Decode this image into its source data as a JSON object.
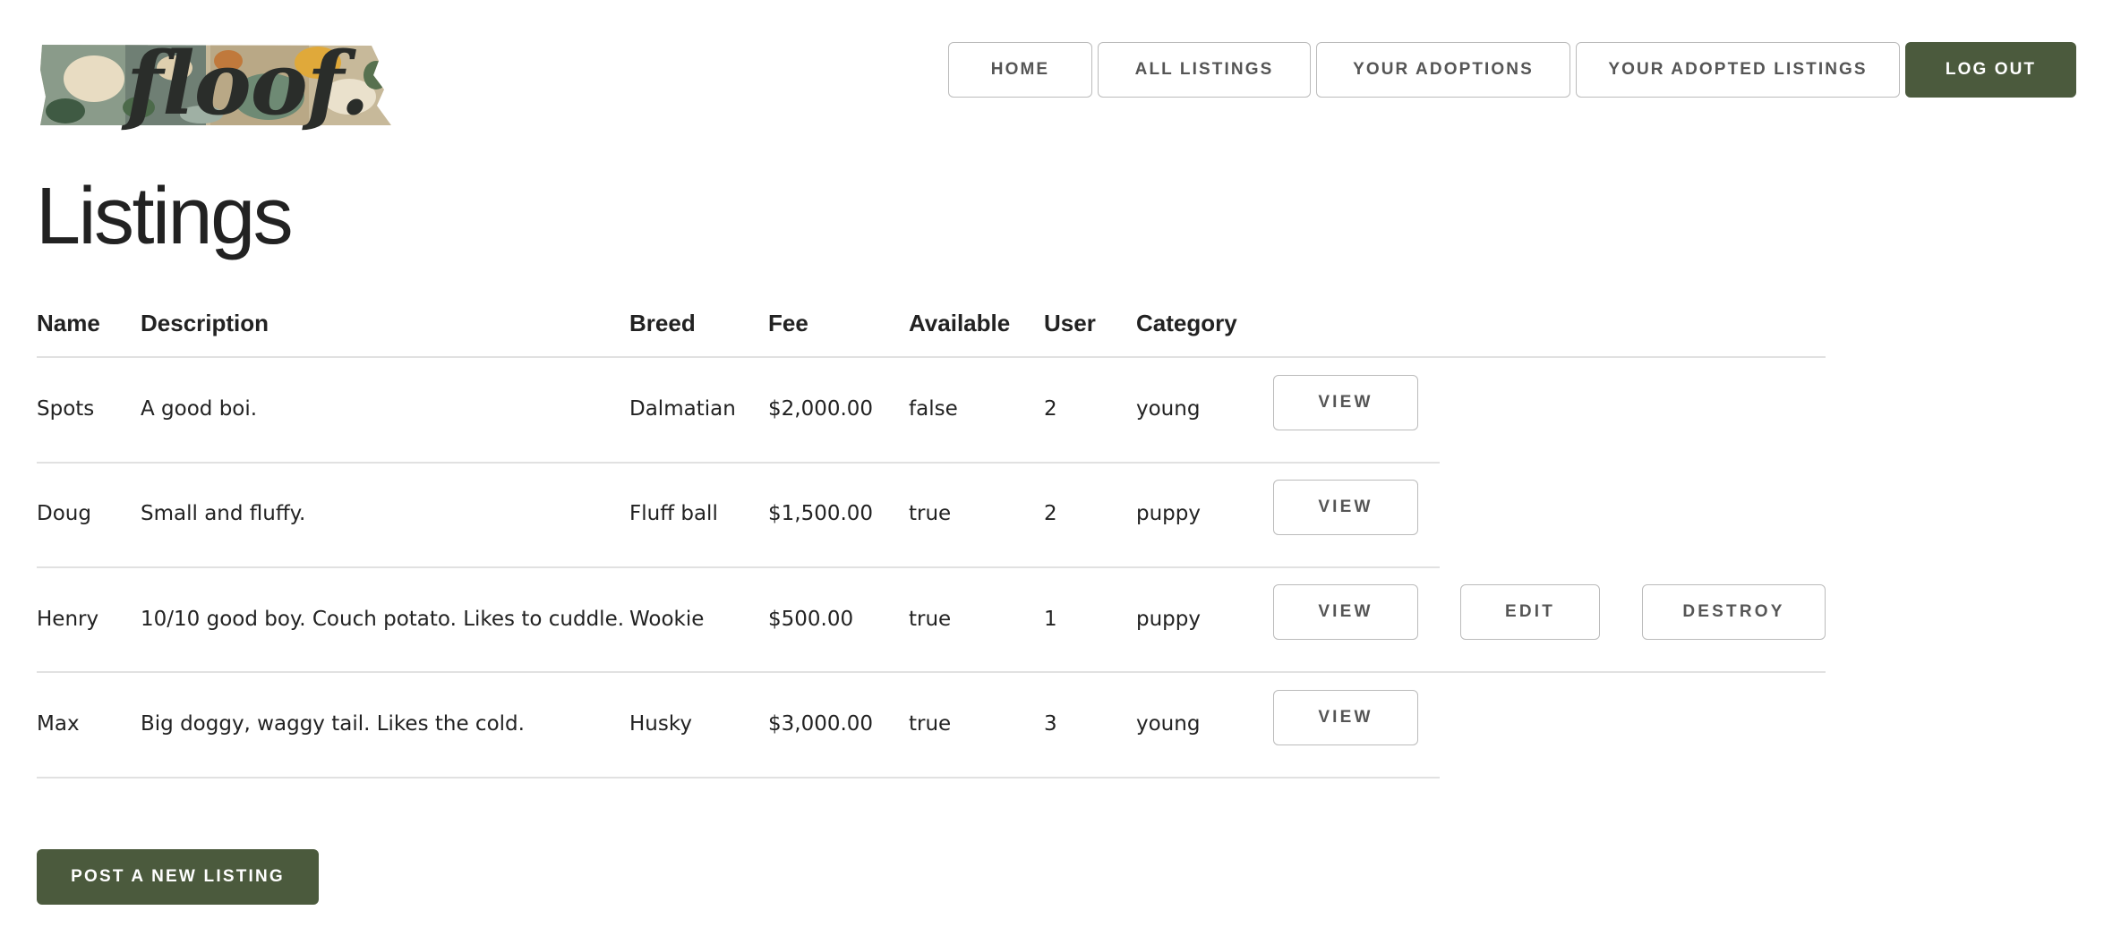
{
  "brand": {
    "logo_text": "floof."
  },
  "nav": {
    "items": [
      {
        "label": "Home"
      },
      {
        "label": "All Listings"
      },
      {
        "label": "Your Adoptions"
      },
      {
        "label": "Your Adopted Listings"
      },
      {
        "label": "Log Out"
      }
    ]
  },
  "page": {
    "title": "Listings"
  },
  "table": {
    "headers": [
      "Name",
      "Description",
      "Breed",
      "Fee",
      "Available",
      "User",
      "Category"
    ],
    "rows": [
      {
        "name": "Spots",
        "description": "A good boi.",
        "breed": "Dalmatian",
        "fee": "$2,000.00",
        "available": "false",
        "user": "2",
        "category": "young",
        "actions": [
          "View"
        ]
      },
      {
        "name": "Doug",
        "description": "Small and fluffy.",
        "breed": "Fluff ball",
        "fee": "$1,500.00",
        "available": "true",
        "user": "2",
        "category": "puppy",
        "actions": [
          "View"
        ]
      },
      {
        "name": "Henry",
        "description": "10/10 good boy. Couch potato. Likes to cuddle.",
        "breed": "Wookie",
        "fee": "$500.00",
        "available": "true",
        "user": "1",
        "category": "puppy",
        "actions": [
          "View",
          "Edit",
          "Destroy"
        ]
      },
      {
        "name": "Max",
        "description": "Big doggy, waggy tail. Likes the cold.",
        "breed": "Husky",
        "fee": "$3,000.00",
        "available": "true",
        "user": "3",
        "category": "young",
        "actions": [
          "View"
        ]
      }
    ]
  },
  "actions": {
    "post_new": "Post a new listing"
  },
  "colors": {
    "primary": "#4b5a3d",
    "border": "#bbbbbb",
    "text": "#222222",
    "divider": "#e1e1e1"
  }
}
